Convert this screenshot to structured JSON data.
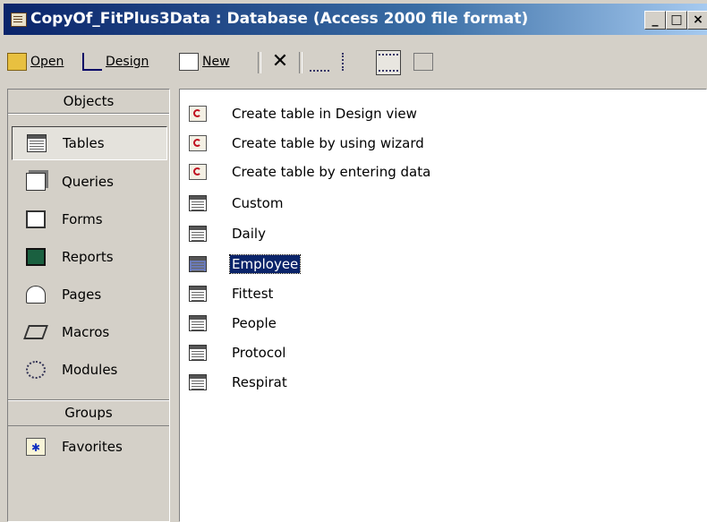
{
  "window": {
    "title": "CopyOf_FitPlus3Data : Database (Access 2000 file format)",
    "controls": {
      "minimize": "_",
      "maximize": "□",
      "close": "×"
    }
  },
  "toolbar": {
    "open_label": "Open",
    "design_label": "Design",
    "new_label": "New",
    "delete_glyph": "✕",
    "icons": [
      "open-icon",
      "design-icon",
      "new-icon",
      "delete-icon",
      "large-icons-icon",
      "small-icons-icon",
      "list-view-icon",
      "details-view-icon"
    ]
  },
  "sidebar": {
    "objects_header": "Objects",
    "items": [
      {
        "label": "Tables",
        "icon": "table-icon",
        "selected": true
      },
      {
        "label": "Queries",
        "icon": "query-icon"
      },
      {
        "label": "Forms",
        "icon": "form-icon"
      },
      {
        "label": "Reports",
        "icon": "report-icon"
      },
      {
        "label": "Pages",
        "icon": "page-icon"
      },
      {
        "label": "Macros",
        "icon": "macro-icon"
      },
      {
        "label": "Modules",
        "icon": "module-icon"
      }
    ],
    "groups_header": "Groups",
    "group_items": [
      {
        "label": "Favorites",
        "icon": "favorites-icon"
      }
    ]
  },
  "list": {
    "items": [
      {
        "label": "Create table in Design view",
        "icon": "wizard-shortcut-icon"
      },
      {
        "label": "Create table by using wizard",
        "icon": "wizard-shortcut-icon"
      },
      {
        "label": "Create table by entering data",
        "icon": "wizard-shortcut-icon"
      },
      {
        "label": "Custom",
        "icon": "table-icon"
      },
      {
        "label": "Daily",
        "icon": "table-icon"
      },
      {
        "label": "Employee",
        "icon": "table-icon",
        "selected": true
      },
      {
        "label": "Fittest",
        "icon": "table-icon"
      },
      {
        "label": "People",
        "icon": "table-icon"
      },
      {
        "label": "Protocol",
        "icon": "table-icon"
      },
      {
        "label": "Respirat",
        "icon": "table-icon"
      }
    ]
  },
  "colors": {
    "titlebar": "#0a246a",
    "selection": "#0a246a",
    "face": "#d4d0c8"
  }
}
